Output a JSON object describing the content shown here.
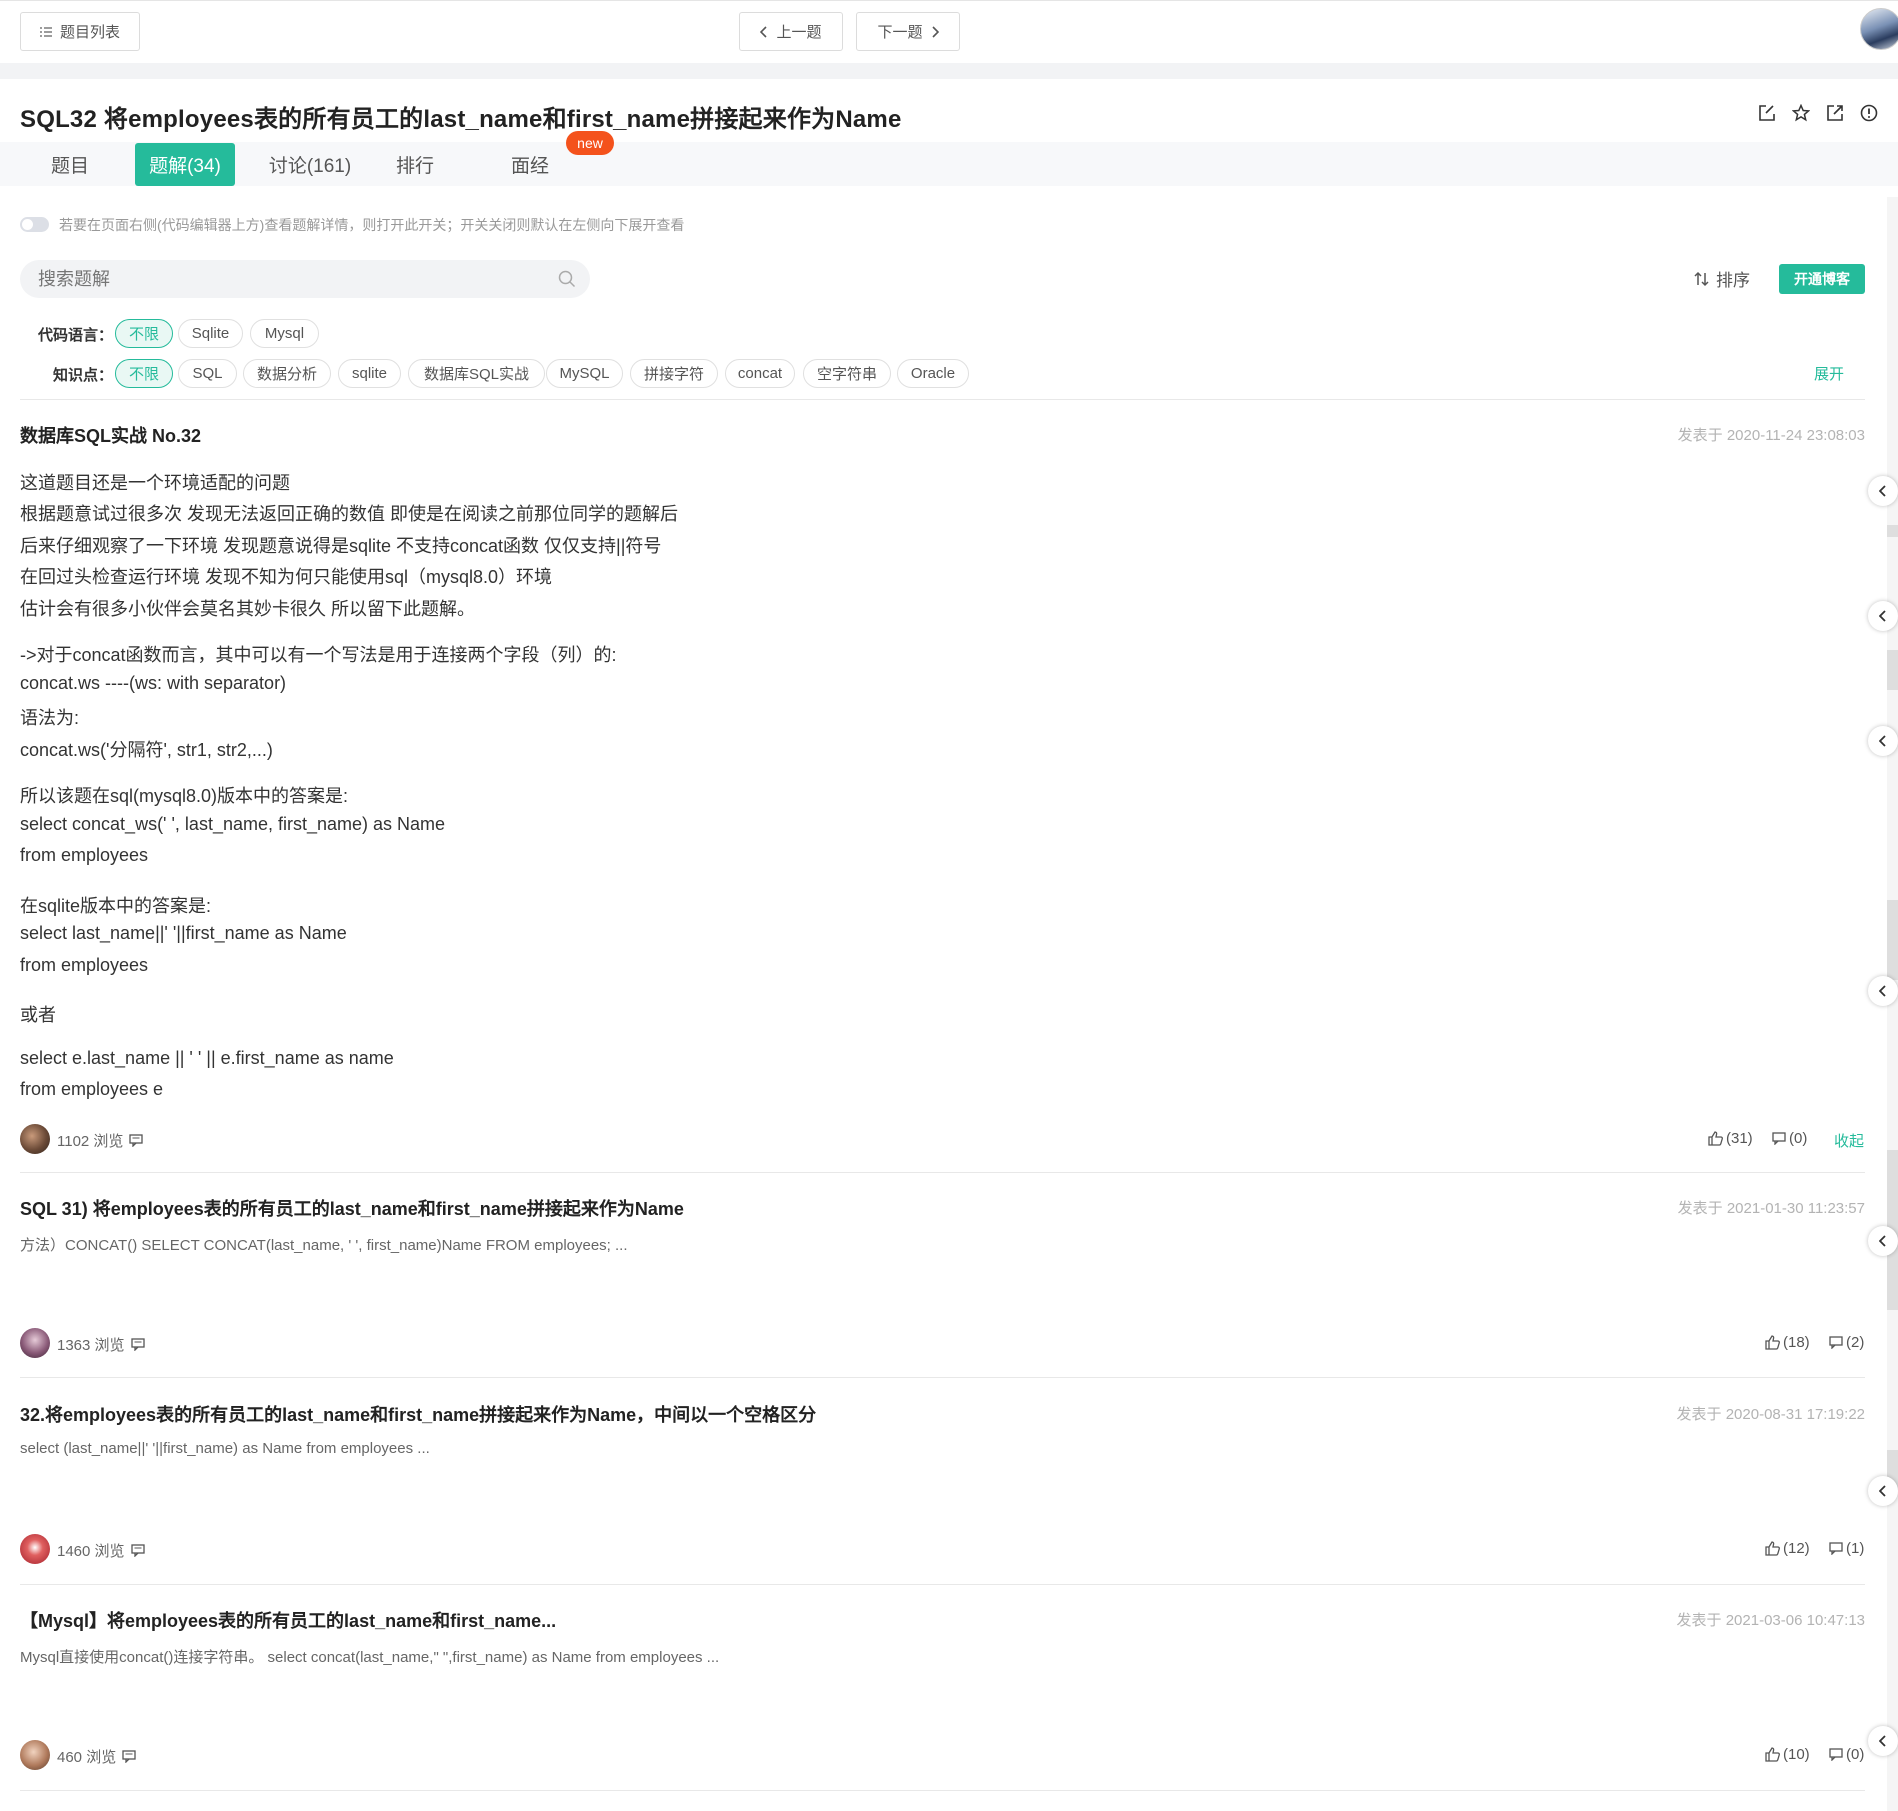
{
  "topbar": {
    "list_button": "题目列表",
    "prev_button": "上一题",
    "next_button": "下一题"
  },
  "problem": {
    "title": "SQL32  将employees表的所有员工的last_name和first_name拼接起来作为Name"
  },
  "tabs": [
    {
      "label": "题目"
    },
    {
      "label": "题解(34)"
    },
    {
      "label": "讨论(161)"
    },
    {
      "label": "排行"
    },
    {
      "label": "面经"
    }
  ],
  "new_badge": "new",
  "toggle_text": "若要在页面右侧(代码编辑器上方)查看题解详情，则打开此开关；开关关闭则默认在左侧向下展开查看",
  "search": {
    "placeholder": "搜索题解"
  },
  "sort_label": "排序",
  "blog_button": "开通博客",
  "filters": {
    "language_label": "代码语言：",
    "languages": [
      "不限",
      "Sqlite",
      "Mysql"
    ],
    "topic_label": "知识点：",
    "topics": [
      "不限",
      "SQL",
      "数据分析",
      "sqlite",
      "数据库SQL实战",
      "MySQL",
      "拼接字符",
      "concat",
      "空字符串",
      "Oracle"
    ],
    "expand_label": "展开"
  },
  "posts": [
    {
      "title": "数据库SQL实战 No.32",
      "date": "发表于 2020-11-24 23:08:03",
      "body": [
        "这道题目还是一个环境适配的问题",
        "根据题意试过很多次 发现无法返回正确的数值 即使是在阅读之前那位同学的题解后",
        "后来仔细观察了一下环境 发现题意说得是sqlite 不支持concat函数 仅仅支持||符号",
        "在回过头检查运行环境 发现不知为何只能使用sql（mysql8.0）环境",
        "估计会有很多小伙伴会莫名其妙卡很久 所以留下此题解。",
        "->对于concat函数而言，其中可以有一个写法是用于连接两个字段（列）的:",
        "concat.ws ----(ws: with separator)",
        "语法为:",
        "concat.ws('分隔符',   str1, str2,...)",
        "所以该题在sql(mysql8.0)版本中的答案是:",
        "select concat_ws(' ', last_name, first_name) as Name",
        "from employees",
        "在sqlite版本中的答案是:",
        "select last_name||' '||first_name as Name",
        "from employees",
        "或者",
        "select e.last_name || ' ' || e.first_name as name",
        "from employees e"
      ],
      "views": "1102 浏览",
      "likes": "(31)",
      "comments": "(0)",
      "collapse_label": "收起"
    },
    {
      "title": "SQL 31) 将employees表的所有员工的last_name和first_name拼接起来作为Name",
      "date": "发表于 2021-01-30 11:23:57",
      "summary": "方法）CONCAT() SELECT CONCAT(last_name, ' ', first_name)Name FROM employees; ...",
      "views": "1363 浏览",
      "likes": "(18)",
      "comments": "(2)"
    },
    {
      "title": "32.将employees表的所有员工的last_name和first_name拼接起来作为Name，中间以一个空格区分",
      "date": "发表于 2020-08-31 17:19:22",
      "summary": "select (last_name||' '||first_name) as Name from employees ...",
      "views": "1460 浏览",
      "likes": "(12)",
      "comments": "(1)"
    },
    {
      "title": "【Mysql】将employees表的所有员工的last_name和first_name...",
      "date": "发表于 2021-03-06 10:47:13",
      "summary": "Mysql直接使用concat()连接字符串。 select concat(last_name,\" \",first_name) as Name from employees ...",
      "views": "460 浏览",
      "likes": "(10)",
      "comments": "(0)"
    }
  ],
  "colors": {
    "accent": "#25bb9b",
    "new_badge": "#f4521c"
  }
}
